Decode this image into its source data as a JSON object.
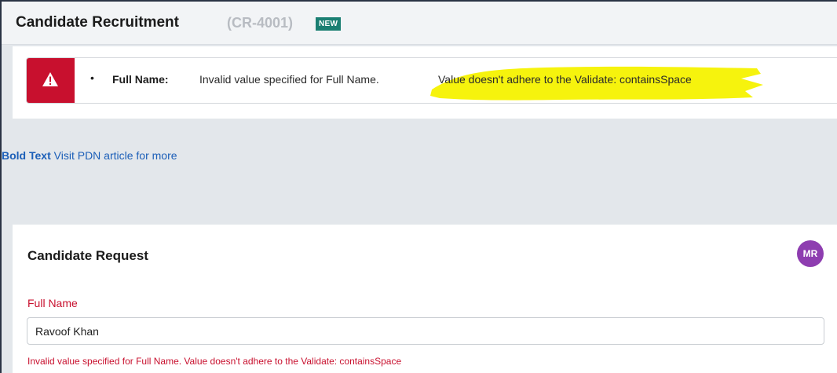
{
  "case": {
    "title": "Candidate Recruitment",
    "id": "(CR-4001)",
    "badge": "NEW"
  },
  "error_banner": {
    "bullet": "•",
    "field_label": "Full Name:",
    "message_prefix": "Invalid value specified for Full Name.",
    "message_highlighted": "Value doesn't adhere to the Validate: containsSpace",
    "highlight_color": "#f5f200",
    "icon": "warning-triangle-icon"
  },
  "info": {
    "bold_text": "Bold Text",
    "link_text": "Visit PDN article for more"
  },
  "form": {
    "section_title": "Candidate Request",
    "avatar_initials": "MR",
    "full_name_label": "Full Name",
    "full_name_value": "Ravoof Khan",
    "full_name_error": "Invalid value specified for Full Name. Value doesn't adhere to the Validate: containsSpace"
  },
  "colors": {
    "error_red": "#c8102e",
    "badge_teal": "#1a7f72",
    "avatar_purple": "#8e3db0",
    "link_blue": "#1c5fb8"
  }
}
